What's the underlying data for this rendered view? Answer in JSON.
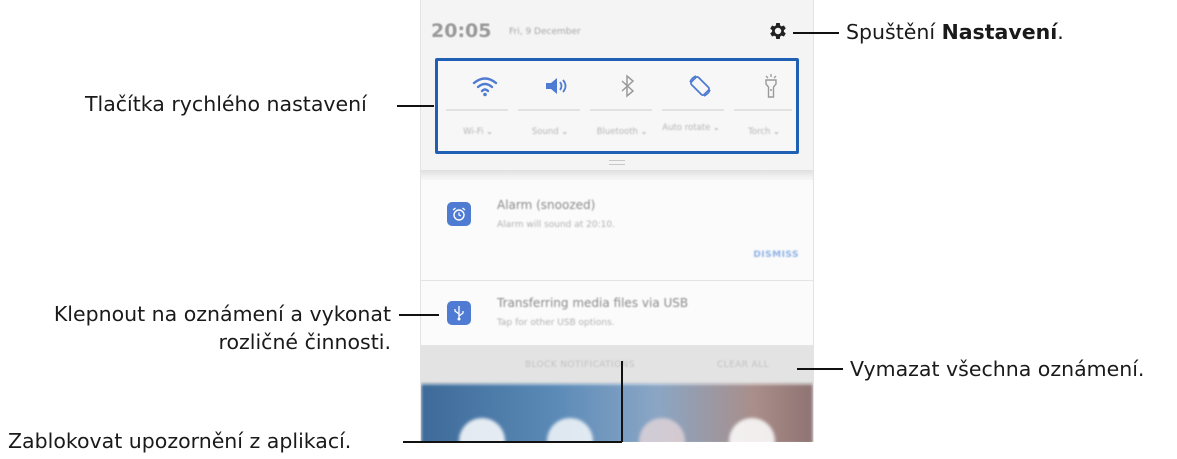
{
  "statusbar": {
    "time": "20:05",
    "date": "Fri, 9 December"
  },
  "quick_settings": [
    {
      "label": "Wi-Fi",
      "icon": "wifi-icon"
    },
    {
      "label": "Sound",
      "icon": "sound-icon"
    },
    {
      "label": "Bluetooth",
      "icon": "bluetooth-icon"
    },
    {
      "label": "Auto rotate",
      "icon": "auto-rotate-icon"
    },
    {
      "label": "Torch",
      "icon": "torch-icon"
    }
  ],
  "notifications": [
    {
      "title": "Alarm (snoozed)",
      "subtitle": "Alarm will sound at 20:10.",
      "action": "DISMISS",
      "icon": "alarm-icon"
    },
    {
      "title": "Transferring media files via USB",
      "subtitle": "Tap for other USB options.",
      "icon": "usb-icon"
    }
  ],
  "action_bar": {
    "block": "BLOCK NOTIFICATIONS",
    "clear": "CLEAR ALL"
  },
  "callouts": {
    "quick_buttons": "Tlačítka rychlého nastavení",
    "settings_prefix": "Spuštění ",
    "settings_bold": "Nastavení",
    "settings_suffix": ".",
    "tap_line1": "Klepnout na oznámení a vykonat",
    "tap_line2": "rozličné činnosti.",
    "clear_all": "Vymazat všechna oznámení.",
    "block": "Zablokovat upozornění z aplikací."
  },
  "colors": {
    "accent": "#1f5fb4",
    "icon_blue": "#4f7bd2"
  }
}
